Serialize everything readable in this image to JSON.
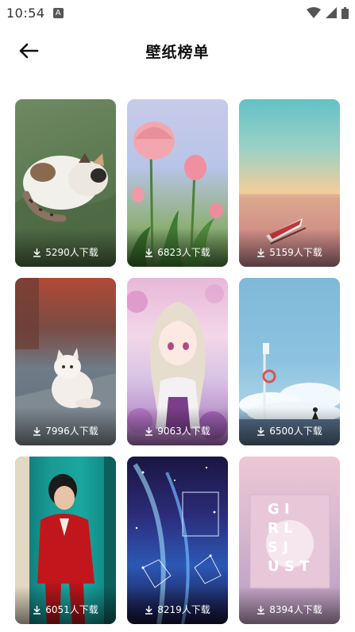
{
  "status_bar": {
    "time": "10:54",
    "notification_icon_letter": "A",
    "icons": [
      "wifi-icon",
      "cell-signal-icon",
      "battery-icon"
    ]
  },
  "toolbar": {
    "title": "壁纸榜单",
    "back_icon": "back-arrow-icon"
  },
  "wallpapers": [
    {
      "downloads": "5290人下载",
      "theme": "cat-on-green-blanket"
    },
    {
      "downloads": "6823人下载",
      "theme": "pink-tulips"
    },
    {
      "downloads": "5159人下载",
      "theme": "boat-at-sunset"
    },
    {
      "downloads": "7996人下载",
      "theme": "white-fluffy-cat"
    },
    {
      "downloads": "9063人下载",
      "theme": "anime-girl-flowers"
    },
    {
      "downloads": "6500人下载",
      "theme": "sky-clouds-cat"
    },
    {
      "downloads": "6051人下载",
      "theme": "man-red-suit"
    },
    {
      "downloads": "8219人下载",
      "theme": "galaxy-constellations"
    },
    {
      "downloads": "8394人下载",
      "theme": "pink-typography-poster"
    }
  ],
  "poster_text": {
    "line1": "G I",
    "line2": "R L",
    "line3": "S J",
    "line4": "U S T"
  },
  "colors": {
    "title": "#111111",
    "download_text": "#ffffff"
  }
}
